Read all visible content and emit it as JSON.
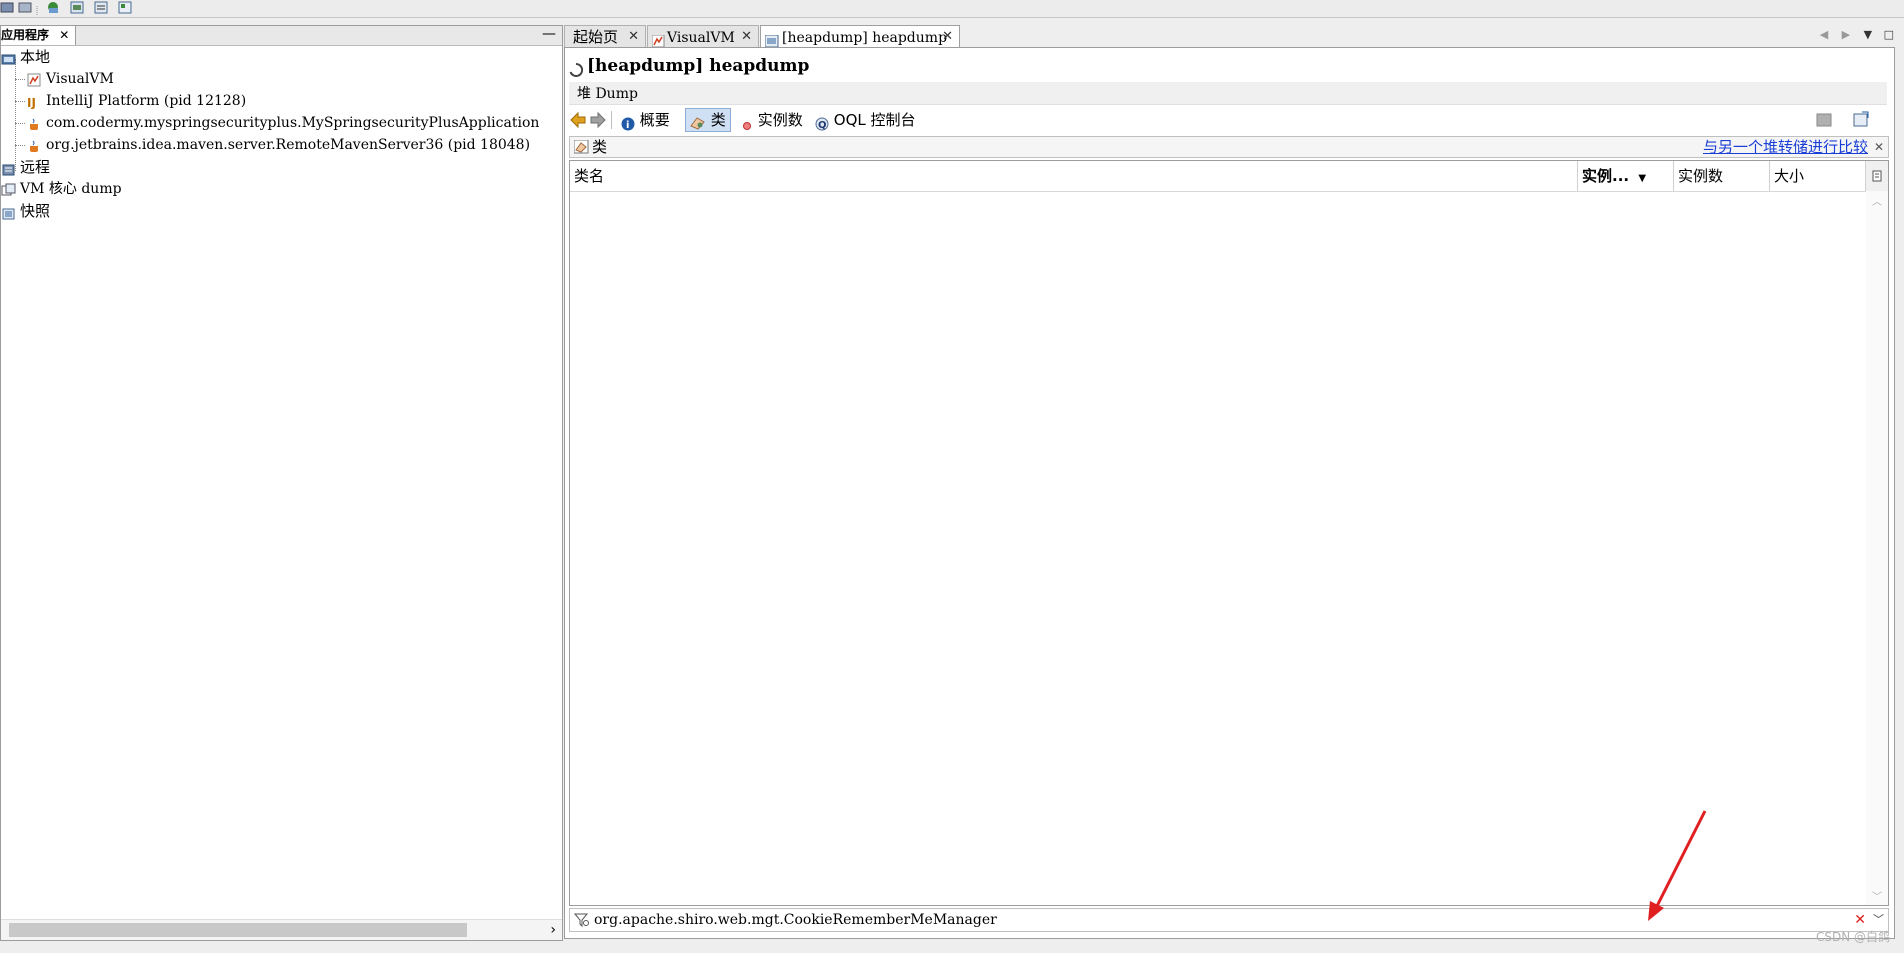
{
  "left_panel": {
    "tab_label": "应用程序",
    "tree": {
      "local": "本地",
      "items": [
        "VisualVM",
        "IntelliJ Platform (pid 12128)",
        "com.codermy.myspringsecurityplus.MySpringsecurityPlusApplication",
        "org.jetbrains.idea.maven.server.RemoteMavenServer36 (pid 18048)"
      ],
      "remote": "远程",
      "vm_core_dump": "VM 核心 dump",
      "snapshots": "快照"
    }
  },
  "tabs": [
    "起始页",
    "VisualVM",
    "[heapdump] heapdump"
  ],
  "heapdump": {
    "title": "[heapdump] heapdump",
    "section_label": "堆 Dump",
    "toolbar": {
      "summary": "概要",
      "classes": "类",
      "instances": "实例数",
      "oql": "OQL 控制台"
    },
    "classes_panel": {
      "label": "类",
      "compare_link": "与另一个堆转储进行比较",
      "columns": [
        "类名",
        "实例...",
        "实例数",
        "大小"
      ]
    },
    "filter_value": "org.apache.shiro.web.mgt.CookieRememberMeManager"
  },
  "watermark": "CSDN @白鸽",
  "colors": {
    "link": "#1a3fd6",
    "selected_button": "#cfe0f4",
    "annotation_arrow": "#e02020"
  }
}
